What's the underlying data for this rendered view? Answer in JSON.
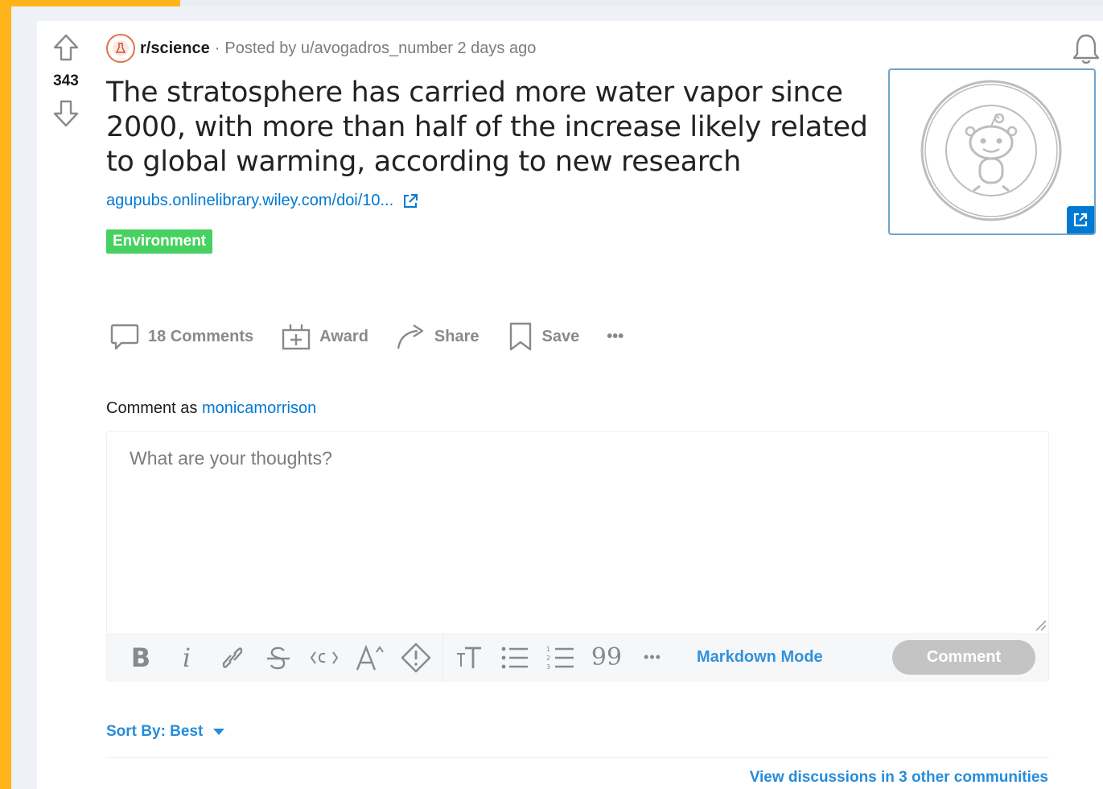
{
  "post": {
    "score": "343",
    "subreddit": "r/science",
    "separator": "·",
    "posted_by": "Posted by u/avogadros_number 2 days ago",
    "title": "The stratosphere has carried more water vapor since 2000, with more than half of the increase likely related to global warming, according to new research",
    "link": "agupubs.onlinelibrary.wiley.com/doi/10...",
    "flair": "Environment",
    "flair_color": "#46d160"
  },
  "actions": {
    "comments": "18 Comments",
    "award": "Award",
    "share": "Share",
    "save": "Save",
    "more": "•••"
  },
  "comment_box": {
    "comment_as_label": "Comment as",
    "username": "monicamorrison",
    "placeholder": "What are your thoughts?",
    "toolbar": {
      "bold": "B",
      "italic": "i",
      "quote": "99",
      "more": "•••"
    },
    "markdown_mode": "Markdown Mode",
    "submit": "Comment"
  },
  "sort": {
    "label": "Sort By: Best"
  },
  "other_discussions": "View discussions in 3 other communities",
  "colors": {
    "accent": "#0079d3",
    "background_orange": "#ffb41a"
  }
}
